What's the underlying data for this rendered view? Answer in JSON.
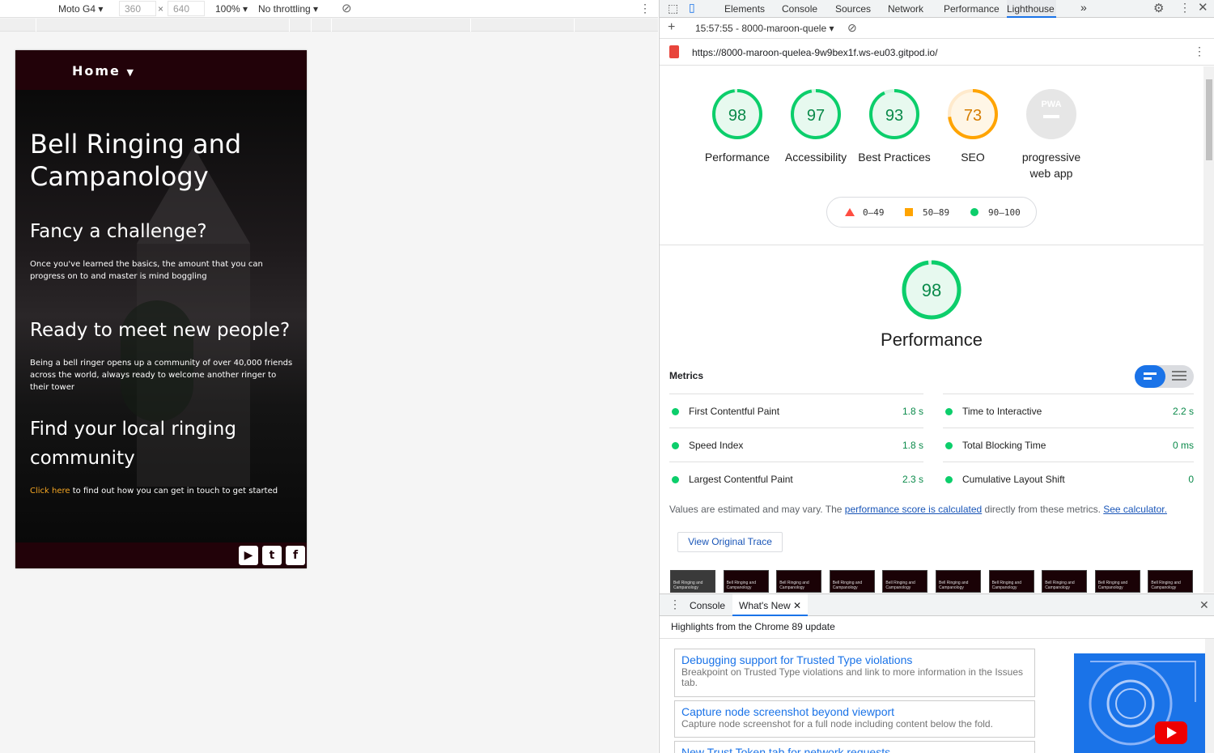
{
  "device_toolbar": {
    "device": "Moto G4",
    "width": "360",
    "height": "640",
    "times": "×",
    "zoom": "100%",
    "throttling": "No throttling"
  },
  "site": {
    "nav_home": "Home",
    "title": "Bell Ringing and Campanology",
    "sections": [
      {
        "heading": "Fancy a challenge?",
        "text": "Once you've learned the basics, the amount that you can progress on to and master is mind boggling"
      },
      {
        "heading": "Ready to meet new people?",
        "text": "Being a bell ringer opens up a community of over 40,000 friends across the world, always ready to welcome another ringer to their tower"
      },
      {
        "heading": "Find your local ringing community",
        "link": "Click here",
        "text": " to find out how you can get in touch to get started"
      }
    ],
    "footer_icons": [
      "youtube-icon",
      "twitter-icon",
      "facebook-icon"
    ]
  },
  "devtools": {
    "tabs": [
      "Elements",
      "Console",
      "Sources",
      "Network",
      "Performance",
      "Lighthouse"
    ],
    "active_tab": "Lighthouse",
    "more": "»",
    "report_time": "15:57:55 - 8000-maroon-quele",
    "url": "https://8000-maroon-quelea-9w9bex1f.ws-eu03.gitpod.io/"
  },
  "lighthouse": {
    "gauges": [
      {
        "score": "98",
        "label": "Performance",
        "value": 98,
        "color": "#0cce6b"
      },
      {
        "score": "97",
        "label": "Accessibility",
        "value": 97,
        "color": "#0cce6b"
      },
      {
        "score": "93",
        "label": "Best Practices",
        "value": 93,
        "color": "#0cce6b"
      },
      {
        "score": "73",
        "label": "SEO",
        "value": 73,
        "color": "#ffa400"
      },
      {
        "score": "PWA",
        "label": "progressive web app",
        "value": 0,
        "color": "#cccccc"
      }
    ],
    "legend": {
      "fail": "0–49",
      "average": "50–89",
      "pass": "90–100"
    },
    "big_score": "98",
    "big_value": 98,
    "category_title": "Performance",
    "metrics_title": "Metrics",
    "metrics": [
      {
        "name": "First Contentful Paint",
        "value": "1.8 s"
      },
      {
        "name": "Time to Interactive",
        "value": "2.2 s"
      },
      {
        "name": "Speed Index",
        "value": "1.8 s"
      },
      {
        "name": "Total Blocking Time",
        "value": "0 ms"
      },
      {
        "name": "Largest Contentful Paint",
        "value": "2.3 s"
      },
      {
        "name": "Cumulative Layout Shift",
        "value": "0"
      }
    ],
    "note_prefix": "Values are estimated and may vary. The ",
    "note_link1": "performance score is calculated",
    "note_mid": " directly from these metrics. ",
    "note_link2": "See calculator.",
    "trace_button": "View Original Trace",
    "thumb_title": "Bell Ringing and Campanology"
  },
  "drawer": {
    "tabs": [
      "Console",
      "What's New"
    ],
    "subtitle": "Highlights from the Chrome 89 update",
    "cards": [
      {
        "title": "Debugging support for Trusted Type violations",
        "desc": "Breakpoint on Trusted Type violations and link to more information in the Issues tab."
      },
      {
        "title": "Capture node screenshot beyond viewport",
        "desc": "Capture node screenshot for a full node including content below the fold."
      },
      {
        "title": "New Trust Token tab for network requests",
        "desc": ""
      }
    ]
  }
}
